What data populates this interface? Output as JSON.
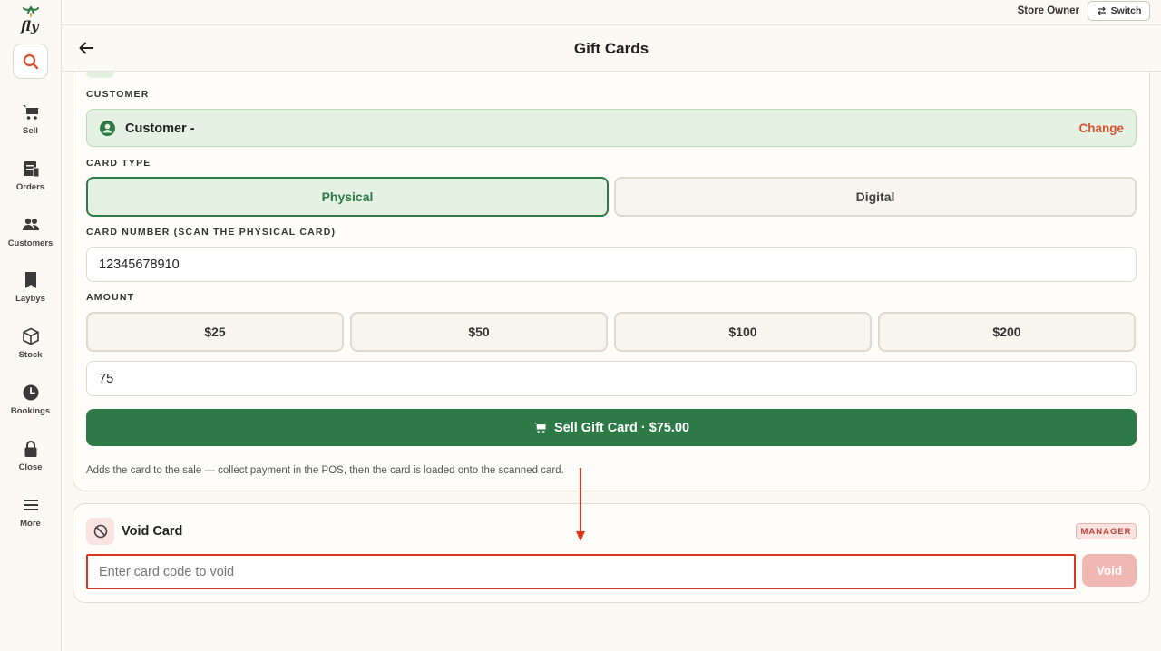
{
  "sidebar": {
    "logo_text": "fly",
    "items": [
      {
        "label": "Sell",
        "icon": "cart-icon"
      },
      {
        "label": "Orders",
        "icon": "orders-icon"
      },
      {
        "label": "Customers",
        "icon": "customers-icon"
      },
      {
        "label": "Laybys",
        "icon": "bookmark-icon"
      },
      {
        "label": "Stock",
        "icon": "box-icon"
      },
      {
        "label": "Bookings",
        "icon": "clock-icon"
      },
      {
        "label": "Close",
        "icon": "lock-icon"
      },
      {
        "label": "More",
        "icon": "menu-icon"
      }
    ]
  },
  "topbar": {
    "user_role": "Store Owner",
    "switch_label": "Switch"
  },
  "header": {
    "title": "Gift Cards"
  },
  "customer": {
    "section_label": "CUSTOMER",
    "name": "Customer -",
    "change_label": "Change"
  },
  "card_type": {
    "section_label": "CARD TYPE",
    "options": [
      "Physical",
      "Digital"
    ],
    "selected": "Physical"
  },
  "card_number": {
    "section_label": "CARD NUMBER (SCAN THE PHYSICAL CARD)",
    "value": "12345678910"
  },
  "amount": {
    "section_label": "AMOUNT",
    "presets": [
      "$25",
      "$50",
      "$100",
      "$200"
    ],
    "custom_value": "75"
  },
  "sell_button": {
    "label": "Sell Gift Card · $75.00"
  },
  "hint": "Adds the card to the sale — collect payment in the POS, then the card is loaded onto the scanned card.",
  "void_card": {
    "title": "Void Card",
    "badge": "MANAGER",
    "placeholder": "Enter card code to void",
    "button_label": "Void"
  },
  "colors": {
    "brand_green": "#2e7a46",
    "light_green": "#e5f2e3",
    "accent_red": "#d9502f",
    "highlight_red": "#d9381f"
  }
}
